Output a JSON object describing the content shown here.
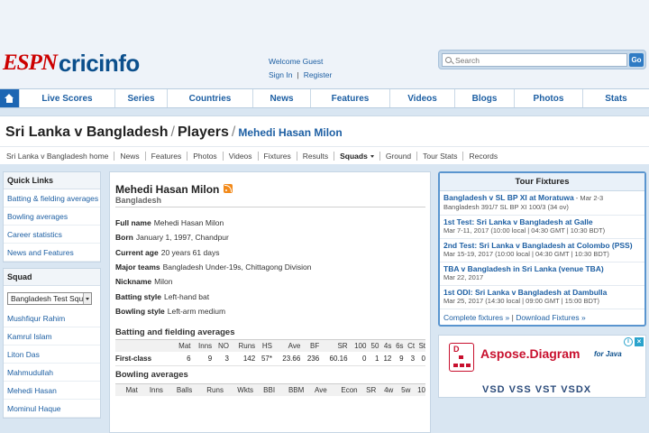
{
  "header": {
    "logo_espn": "ESPN",
    "logo_cricinfo": "cricinfo",
    "welcome": "Welcome Guest",
    "signin": "Sign In",
    "register": "Register",
    "search_placeholder": "Search",
    "search_button": "Go"
  },
  "nav": {
    "items": [
      "Live Scores",
      "Series",
      "Countries",
      "News",
      "Features",
      "Videos",
      "Blogs",
      "Photos",
      "Stats"
    ]
  },
  "breadcrumb": {
    "series": "Sri Lanka v Bangladesh",
    "section": "Players",
    "player": "Mehedi Hasan Milon"
  },
  "subnav": [
    "Sri Lanka v Bangladesh home",
    "News",
    "Features",
    "Photos",
    "Videos",
    "Fixtures",
    "Results",
    "Squads",
    "Ground",
    "Tour Stats",
    "Records"
  ],
  "quick_links": {
    "title": "Quick Links",
    "items": [
      "Batting & fielding averages",
      "Bowling averages",
      "Career statistics",
      "News and Features"
    ]
  },
  "squad": {
    "title": "Squad",
    "selected": "Bangladesh Test Squad",
    "members": [
      "Mushfiqur Rahim",
      "Kamrul Islam",
      "Liton Das",
      "Mahmudullah",
      "Mehedi Hasan",
      "Mominul Haque"
    ]
  },
  "player": {
    "name": "Mehedi Hasan Milon",
    "team": "Bangladesh",
    "info": {
      "full_name_label": "Full name",
      "full_name": "Mehedi Hasan Milon",
      "born_label": "Born",
      "born": "January 1, 1997, Chandpur",
      "age_label": "Current age",
      "age": "20 years 61 days",
      "teams_label": "Major teams",
      "teams": "Bangladesh Under-19s, Chittagong Division",
      "nickname_label": "Nickname",
      "nickname": "Milon",
      "batting_label": "Batting style",
      "batting": "Left-hand bat",
      "bowling_label": "Bowling style",
      "bowling": "Left-arm medium"
    }
  },
  "batting": {
    "title": "Batting and fielding averages",
    "headers": [
      "",
      "Mat",
      "Inns",
      "NO",
      "Runs",
      "HS",
      "Ave",
      "BF",
      "SR",
      "100",
      "50",
      "4s",
      "6s",
      "Ct",
      "St"
    ],
    "rows": [
      [
        "First-class",
        "6",
        "9",
        "3",
        "142",
        "57*",
        "23.66",
        "236",
        "60.16",
        "0",
        "1",
        "12",
        "9",
        "3",
        "0"
      ]
    ]
  },
  "bowling": {
    "title": "Bowling averages",
    "headers": [
      "",
      "Mat",
      "Inns",
      "Balls",
      "Runs",
      "Wkts",
      "BBI",
      "BBM",
      "Ave",
      "Econ",
      "SR",
      "4w",
      "5w",
      "10"
    ]
  },
  "fixtures": {
    "title": "Tour Fixtures",
    "items": [
      {
        "title": "Bangladesh v SL BP XI at Moratuwa",
        "date": "Mar 2-3",
        "detail": "Bangladesh 391/7 SL BP XI 100/3 (34 ov)"
      },
      {
        "title": "1st Test: Sri Lanka v Bangladesh at Galle",
        "date": "",
        "detail": "Mar 7-11, 2017 (10:00 local | 04:30 GMT | 10:30 BDT)"
      },
      {
        "title": "2nd Test: Sri Lanka v Bangladesh at Colombo (PSS)",
        "date": "",
        "detail": "Mar 15-19, 2017 (10:00 local | 04:30 GMT | 10:30 BDT)"
      },
      {
        "title": "TBA v Bangladesh in Sri Lanka (venue TBA)",
        "date": "",
        "detail": "Mar 22, 2017"
      },
      {
        "title": "1st ODI: Sri Lanka v Bangladesh at Dambulla",
        "date": "",
        "detail": "Mar 25, 2017 (14:30 local | 09:00 GMT | 15:00 BDT)"
      }
    ],
    "complete_link": "Complete fixtures »",
    "download_link": "Download Fixtures »"
  },
  "ad": {
    "title": "Aspose.Diagram",
    "subtitle": "for Java",
    "formats": "VSD VSS VST VSDX",
    "logo_letter": "D"
  },
  "colors": {
    "brand_red": "#cc0000",
    "brand_blue": "#0b4f8c",
    "link_blue": "#1d5fa3"
  }
}
